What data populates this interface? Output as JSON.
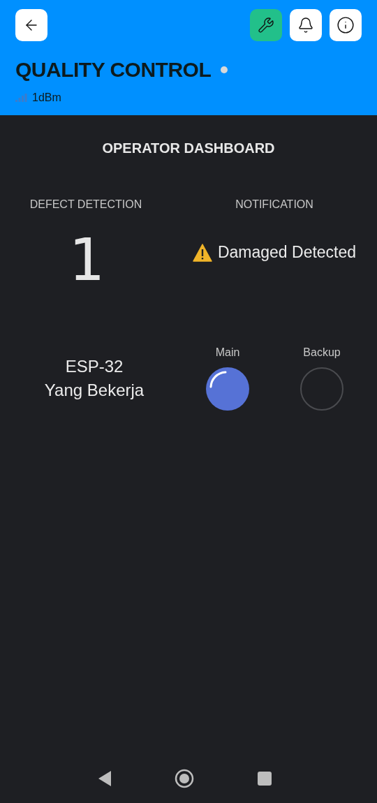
{
  "header": {
    "title": "QUALITY CONTROL",
    "online": false,
    "signal": "1dBm",
    "tools_active": true
  },
  "dashboard": {
    "title": "OPERATOR DASHBOARD",
    "defect": {
      "label": "DEFECT DETECTION",
      "value": "1"
    },
    "notification": {
      "label": "NOTIFICATION",
      "message": "Damaged Detected"
    },
    "device": {
      "lines": [
        "ESP-32",
        "Yang Bekerja"
      ],
      "leds": [
        {
          "label": "Main",
          "on": true
        },
        {
          "label": "Backup",
          "on": false
        }
      ]
    }
  }
}
